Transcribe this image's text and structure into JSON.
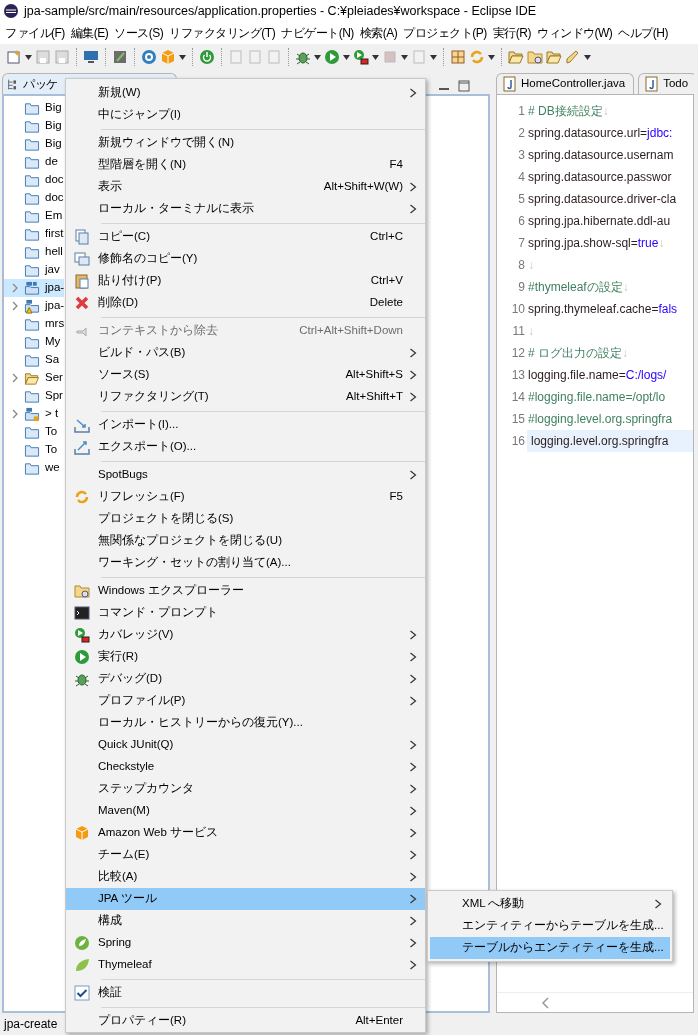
{
  "window": {
    "title": "jpa-sample/src/main/resources/application.properties - C:¥pleiades¥workspace - Eclipse IDE"
  },
  "menu_bar": [
    "ファイル(F)",
    "編集(E)",
    "ソース(S)",
    "リファクタリング(T)",
    "ナビゲート(N)",
    "検索(A)",
    "プロジェクト(P)",
    "実行(R)",
    "ウィンドウ(W)",
    "ヘルプ(H)"
  ],
  "explorer": {
    "tab": "パッケ",
    "items": [
      {
        "label": "Big",
        "kind": "folder",
        "has_children": false,
        "selected": false
      },
      {
        "label": "Big",
        "kind": "folder",
        "has_children": false,
        "selected": false
      },
      {
        "label": "Big",
        "kind": "folder",
        "has_children": false,
        "selected": false
      },
      {
        "label": "de",
        "kind": "folder",
        "has_children": false,
        "selected": false
      },
      {
        "label": "doc",
        "kind": "folder",
        "has_children": false,
        "selected": false
      },
      {
        "label": "doc",
        "kind": "folder",
        "has_children": false,
        "selected": false
      },
      {
        "label": "Em",
        "kind": "folder",
        "has_children": false,
        "selected": false
      },
      {
        "label": "first",
        "kind": "folder",
        "has_children": false,
        "selected": false
      },
      {
        "label": "hell",
        "kind": "folder",
        "has_children": false,
        "selected": false
      },
      {
        "label": "jav",
        "kind": "folder",
        "has_children": false,
        "selected": false
      },
      {
        "label": "jpa-",
        "kind": "java-project",
        "has_children": true,
        "selected": true
      },
      {
        "label": "jpa-",
        "kind": "warning-project",
        "has_children": true,
        "selected": false
      },
      {
        "label": "mrs",
        "kind": "folder",
        "has_children": false,
        "selected": false
      },
      {
        "label": "My",
        "kind": "folder",
        "has_children": false,
        "selected": false
      },
      {
        "label": "Sa",
        "kind": "folder",
        "has_children": false,
        "selected": false
      },
      {
        "label": "Ser",
        "kind": "open-folder",
        "has_children": true,
        "selected": false
      },
      {
        "label": "Spr",
        "kind": "folder",
        "has_children": false,
        "selected": false
      },
      {
        "label": "> t",
        "kind": "locked-project",
        "has_children": true,
        "selected": false
      },
      {
        "label": "To",
        "kind": "folder",
        "has_children": false,
        "selected": false
      },
      {
        "label": "To",
        "kind": "folder",
        "has_children": false,
        "selected": false
      },
      {
        "label": "we",
        "kind": "folder",
        "has_children": false,
        "selected": false
      }
    ]
  },
  "editor": {
    "tabs": [
      "HomeController.java",
      "Todo"
    ],
    "lines": [
      {
        "number": "1",
        "current": false,
        "segments": [
          {
            "kind": "comment",
            "text": "# DB接続設定"
          }
        ],
        "eol": "↓"
      },
      {
        "number": "2",
        "current": false,
        "segments": [
          {
            "kind": "key",
            "text": "spring.datasource.url="
          },
          {
            "kind": "value",
            "text": "jdbc:"
          }
        ]
      },
      {
        "number": "3",
        "current": false,
        "segments": [
          {
            "kind": "key",
            "text": "spring.datasource.usernam"
          }
        ]
      },
      {
        "number": "4",
        "current": false,
        "segments": [
          {
            "kind": "key",
            "text": "spring.datasource.passwor"
          }
        ]
      },
      {
        "number": "5",
        "current": false,
        "segments": [
          {
            "kind": "key",
            "text": "spring.datasource.driver-cla"
          }
        ]
      },
      {
        "number": "6",
        "current": false,
        "segments": [
          {
            "kind": "key",
            "text": "spring.jpa.hibernate.ddl-au"
          }
        ]
      },
      {
        "number": "7",
        "current": false,
        "segments": [
          {
            "kind": "key",
            "text": "spring.jpa.show-sql="
          },
          {
            "kind": "value",
            "text": "true"
          }
        ],
        "eol": "↓"
      },
      {
        "number": "8",
        "current": false,
        "eol": "↓"
      },
      {
        "number": "9",
        "current": false,
        "segments": [
          {
            "kind": "comment",
            "text": "#thymeleafの設定"
          }
        ],
        "eol": "↓"
      },
      {
        "number": "10",
        "current": false,
        "segments": [
          {
            "kind": "key",
            "text": "spring.thymeleaf.cache="
          },
          {
            "kind": "value",
            "text": "fals"
          }
        ]
      },
      {
        "number": "11",
        "current": false,
        "eol": "↓"
      },
      {
        "number": "12",
        "current": false,
        "segments": [
          {
            "kind": "comment",
            "text": "# ログ出力の設定"
          }
        ],
        "eol": "↓"
      },
      {
        "number": "13",
        "current": false,
        "segments": [
          {
            "kind": "key",
            "text": "logging.file.name="
          },
          {
            "kind": "value",
            "text": "C:/logs/"
          }
        ]
      },
      {
        "number": "14",
        "current": false,
        "segments": [
          {
            "kind": "comment",
            "text": "#logging.file.name=/opt/lo"
          }
        ]
      },
      {
        "number": "15",
        "current": false,
        "segments": [
          {
            "kind": "comment",
            "text": "#logging.level.org.springfra"
          }
        ]
      },
      {
        "number": "16",
        "current": true,
        "segments": [
          {
            "kind": "key",
            "text": "logging.level.org.springfra"
          }
        ]
      }
    ]
  },
  "context_menu": {
    "groups": [
      [
        {
          "label": "新規(W)",
          "kind": "action",
          "submenu": true,
          "disabled": false,
          "selected": false
        },
        {
          "label": "中にジャンプ(I)",
          "kind": "action",
          "submenu": false,
          "disabled": false,
          "selected": false
        }
      ],
      [
        {
          "label": "新規ウィンドウで開く(N)",
          "kind": "action",
          "submenu": false,
          "disabled": false,
          "selected": false
        },
        {
          "label": "型階層を開く(N)",
          "shortcut": "F4",
          "kind": "action",
          "submenu": false,
          "disabled": false,
          "selected": false
        },
        {
          "label": "表示",
          "shortcut": "Alt+Shift+W(W)",
          "kind": "action",
          "submenu": true,
          "disabled": false,
          "selected": false
        },
        {
          "label": "ローカル・ターミナルに表示",
          "kind": "action",
          "submenu": true,
          "disabled": false,
          "selected": false
        }
      ],
      [
        {
          "label": "コピー(C)",
          "shortcut": "Ctrl+C",
          "kind": "action",
          "submenu": false,
          "disabled": false,
          "selected": false
        },
        {
          "label": "修飾名のコピー(Y)",
          "kind": "action",
          "submenu": false,
          "disabled": false,
          "selected": false
        },
        {
          "label": "貼り付け(P)",
          "shortcut": "Ctrl+V",
          "kind": "action",
          "submenu": false,
          "disabled": false,
          "selected": false
        },
        {
          "label": "削除(D)",
          "shortcut": "Delete",
          "kind": "action",
          "submenu": false,
          "disabled": false,
          "selected": false
        }
      ],
      [
        {
          "label": "コンテキストから除去",
          "shortcut": "Ctrl+Alt+Shift+Down",
          "kind": "action",
          "submenu": false,
          "disabled": true,
          "selected": false
        },
        {
          "label": "ビルド・パス(B)",
          "kind": "action",
          "submenu": true,
          "disabled": false,
          "selected": false
        },
        {
          "label": "ソース(S)",
          "shortcut": "Alt+Shift+S",
          "kind": "action",
          "submenu": true,
          "disabled": false,
          "selected": false
        },
        {
          "label": "リファクタリング(T)",
          "shortcut": "Alt+Shift+T",
          "kind": "action",
          "submenu": true,
          "disabled": false,
          "selected": false
        }
      ],
      [
        {
          "label": "インポート(I)...",
          "kind": "action",
          "submenu": false,
          "disabled": false,
          "selected": false
        },
        {
          "label": "エクスポート(O)...",
          "kind": "action",
          "submenu": false,
          "disabled": false,
          "selected": false
        }
      ],
      [
        {
          "label": "SpotBugs",
          "kind": "action",
          "submenu": true,
          "disabled": false,
          "selected": false
        },
        {
          "label": "リフレッシュ(F)",
          "shortcut": "F5",
          "kind": "action",
          "submenu": false,
          "disabled": false,
          "selected": false
        },
        {
          "label": "プロジェクトを閉じる(S)",
          "kind": "action",
          "submenu": false,
          "disabled": false,
          "selected": false
        },
        {
          "label": "無関係なプロジェクトを閉じる(U)",
          "kind": "action",
          "submenu": false,
          "disabled": false,
          "selected": false
        },
        {
          "label": "ワーキング・セットの割り当て(A)...",
          "kind": "action",
          "submenu": false,
          "disabled": false,
          "selected": false
        }
      ],
      [
        {
          "label": "Windows エクスプローラー",
          "kind": "action",
          "submenu": false,
          "disabled": false,
          "selected": false
        },
        {
          "label": "コマンド・プロンプト",
          "kind": "action",
          "submenu": false,
          "disabled": false,
          "selected": false
        },
        {
          "label": "カバレッジ(V)",
          "kind": "action",
          "submenu": true,
          "disabled": false,
          "selected": false
        },
        {
          "label": "実行(R)",
          "kind": "action",
          "submenu": true,
          "disabled": false,
          "selected": false
        },
        {
          "label": "デバッグ(D)",
          "kind": "action",
          "submenu": true,
          "disabled": false,
          "selected": false
        },
        {
          "label": "プロファイル(P)",
          "kind": "action",
          "submenu": true,
          "disabled": false,
          "selected": false
        },
        {
          "label": "ローカル・ヒストリーからの復元(Y)...",
          "kind": "action",
          "submenu": false,
          "disabled": false,
          "selected": false
        },
        {
          "label": "Quick JUnit(Q)",
          "kind": "action",
          "submenu": true,
          "disabled": false,
          "selected": false
        },
        {
          "label": "Checkstyle",
          "kind": "action",
          "submenu": true,
          "disabled": false,
          "selected": false
        },
        {
          "label": "ステップカウンタ",
          "kind": "action",
          "submenu": true,
          "disabled": false,
          "selected": false
        },
        {
          "label": "Maven(M)",
          "kind": "action",
          "submenu": true,
          "disabled": false,
          "selected": false
        },
        {
          "label": "Amazon Web サービス",
          "kind": "action",
          "submenu": true,
          "disabled": false,
          "selected": false
        },
        {
          "label": "チーム(E)",
          "kind": "action",
          "submenu": true,
          "disabled": false,
          "selected": false
        },
        {
          "label": "比較(A)",
          "kind": "action",
          "submenu": true,
          "disabled": false,
          "selected": false
        },
        {
          "label": "JPA ツール",
          "kind": "action",
          "submenu": true,
          "disabled": false,
          "selected": true
        },
        {
          "label": "構成",
          "kind": "action",
          "submenu": true,
          "disabled": false,
          "selected": false
        },
        {
          "label": "Spring",
          "kind": "action",
          "submenu": true,
          "disabled": false,
          "selected": false
        },
        {
          "label": "Thymeleaf",
          "kind": "action",
          "submenu": true,
          "disabled": false,
          "selected": false
        }
      ],
      [
        {
          "label": "検証",
          "kind": "check",
          "checked": true,
          "submenu": false,
          "disabled": false,
          "selected": false
        }
      ],
      [
        {
          "label": "プロパティー(R)",
          "shortcut": "Alt+Enter",
          "kind": "action",
          "submenu": false,
          "disabled": false,
          "selected": false
        }
      ]
    ]
  },
  "submenu": {
    "items": [
      {
        "label": "XML へ移動",
        "submenu": true,
        "selected": false
      },
      {
        "label": "エンティティーからテーブルを生成...",
        "submenu": false,
        "selected": false
      },
      {
        "label": "テーブルからエンティティーを生成...",
        "submenu": false,
        "selected": true
      }
    ]
  },
  "status_bar": {
    "text": "jpa-create"
  }
}
